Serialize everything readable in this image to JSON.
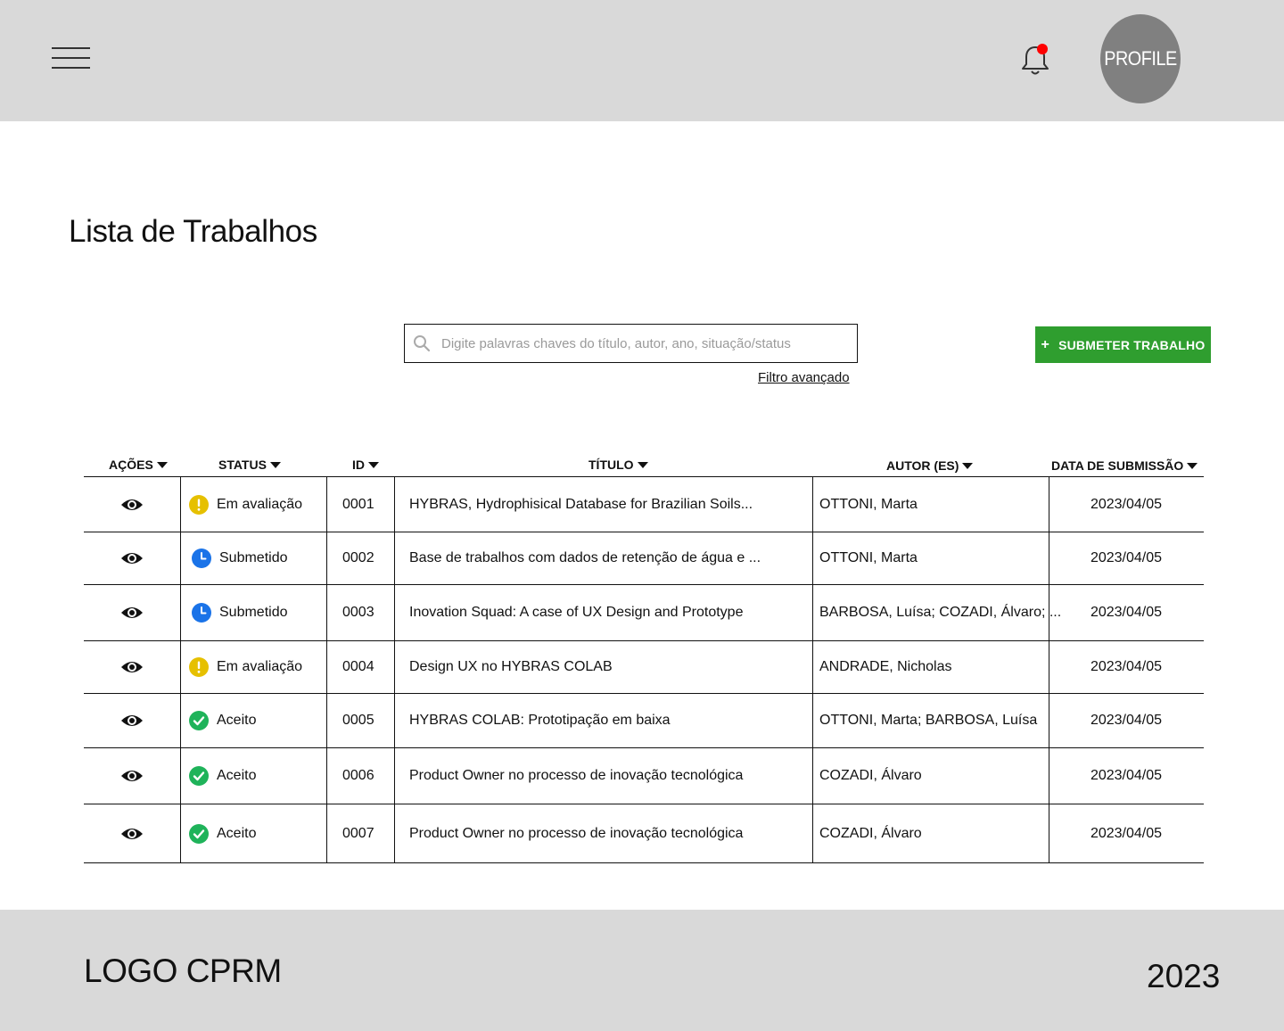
{
  "header": {
    "profile_label": "PROFILE",
    "notification_dot_color": "#ff0000"
  },
  "page": {
    "title": "Lista de Trabalhos"
  },
  "search": {
    "placeholder": "Digite palavras chaves do título, autor, ano, situação/status",
    "advanced_filter_label": "Filtro avançado"
  },
  "actions": {
    "submit_label": "SUBMETER TRABALHO",
    "submit_icon": "+",
    "submit_color": "#2f9e2f"
  },
  "table": {
    "columns": {
      "acoes": "AÇÕES",
      "status": "STATUS",
      "id": "ID",
      "titulo": "TÍTULO",
      "autor": "AUTOR (ES)",
      "data": "DATA DE SUBMISSÃO"
    },
    "rows": [
      {
        "status": "Em avaliação",
        "status_icon": "warning-icon",
        "id": "0001",
        "titulo": "HYBRAS, Hydrophisical Database for Brazilian Soils...",
        "autor": "OTTONI, Marta",
        "data": "2023/04/05"
      },
      {
        "status": "Submetido",
        "status_icon": "clock-icon",
        "id": "0002",
        "titulo": "Base de trabalhos com dados de retenção de água e ...",
        "autor": "OTTONI, Marta",
        "data": "2023/04/05"
      },
      {
        "status": "Submetido",
        "status_icon": "clock-icon",
        "id": "0003",
        "titulo": "Inovation Squad: A case of UX Design and Prototype",
        "autor": "BARBOSA, Luísa; COZADI, Álvaro; ...",
        "data": "2023/04/05"
      },
      {
        "status": "Em avaliação",
        "status_icon": "warning-icon",
        "id": "0004",
        "titulo": "Design UX no HYBRAS COLAB",
        "autor": "ANDRADE, Nicholas",
        "data": "2023/04/05"
      },
      {
        "status": "Aceito",
        "status_icon": "check-icon",
        "id": "0005",
        "titulo": "HYBRAS COLAB: Prototipação em baixa",
        "autor": "OTTONI, Marta; BARBOSA, Luísa",
        "data": "2023/04/05"
      },
      {
        "status": "Aceito",
        "status_icon": "check-icon",
        "id": "0006",
        "titulo": "Product Owner no processo de inovação tecnológica",
        "autor": "COZADI, Álvaro",
        "data": "2023/04/05"
      },
      {
        "status": "Aceito",
        "status_icon": "check-icon",
        "id": "0007",
        "titulo": "Product Owner no processo de inovação tecnológica",
        "autor": "COZADI, Álvaro",
        "data": "2023/04/05"
      }
    ],
    "status_colors": {
      "warning-icon": "#e6c000",
      "clock-icon": "#1a73e8",
      "check-icon": "#1fb35a"
    }
  },
  "footer": {
    "logo": "LOGO CPRM",
    "year": "2023"
  }
}
